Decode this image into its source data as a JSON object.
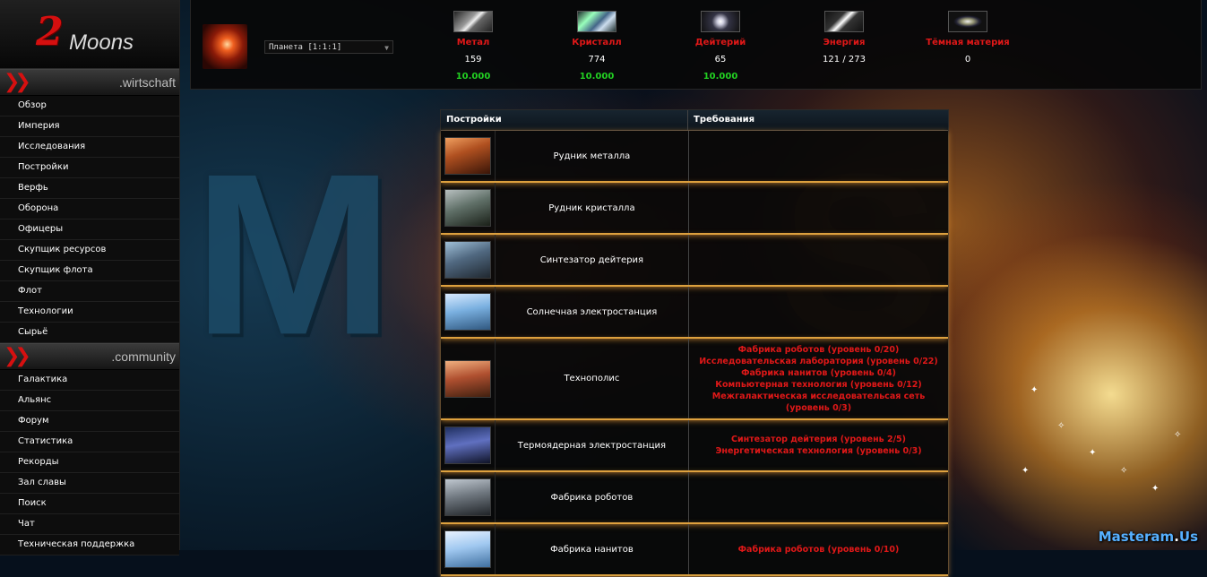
{
  "logo": {
    "number": "2",
    "word": "Moons"
  },
  "menu": {
    "sections": [
      {
        "title": ".wirtschaft",
        "items": [
          "Обзор",
          "Империя",
          "Исследования",
          "Постройки",
          "Верфь",
          "Оборона",
          "Офицеры",
          "Скупщик ресурсов",
          "Скупщик флота",
          "Флот",
          "Технологии",
          "Сырьё"
        ]
      },
      {
        "title": ".community",
        "items": [
          "Галактика",
          "Альянс",
          "Форум",
          "Статистика",
          "Рекорды",
          "Зал славы",
          "Поиск",
          "Чат",
          "Техническая поддержка"
        ]
      }
    ]
  },
  "topbar": {
    "planet_select": "Планета [1:1:1]",
    "resources": [
      {
        "name": "Метал",
        "amount": "159",
        "capacity": "10.000",
        "icon": "metal-icon"
      },
      {
        "name": "Кристалл",
        "amount": "774",
        "capacity": "10.000",
        "icon": "crystal-icon"
      },
      {
        "name": "Дейтерий",
        "amount": "65",
        "capacity": "10.000",
        "icon": "deuterium-icon"
      },
      {
        "name": "Энергия",
        "amount": "121 / 273",
        "capacity": "",
        "icon": "energy-icon"
      },
      {
        "name": "Тёмная материя",
        "amount": "0",
        "capacity": "",
        "icon": "dark-matter-icon"
      }
    ]
  },
  "table": {
    "headers": {
      "buildings": "Постройки",
      "requirements": "Требования"
    },
    "rows": [
      {
        "name": "Рудник металла",
        "requirements": []
      },
      {
        "name": "Рудник кристалла",
        "requirements": []
      },
      {
        "name": "Синтезатор дейтерия",
        "requirements": []
      },
      {
        "name": "Солнечная электростанция",
        "requirements": []
      },
      {
        "name": "Технополис",
        "requirements": [
          "Фабрика роботов (уровень 0/20)",
          "Исследовательская лаборатория (уровень 0/22)",
          "Фабрика нанитов (уровень 0/4)",
          "Компьютерная технология (уровень 0/12)",
          "Межгалактическая исследовательсая сеть (уровень 0/3)"
        ]
      },
      {
        "name": "Термоядерная электростанция",
        "requirements": [
          "Синтезатор дейтерия (уровень 2/5)",
          "Энергетическая технология (уровень 0/3)"
        ]
      },
      {
        "name": "Фабрика роботов",
        "requirements": []
      },
      {
        "name": "Фабрика нанитов",
        "requirements": [
          "Фабрика роботов (уровень 0/10)"
        ]
      }
    ]
  },
  "background": {
    "watermark_left": "Masteram",
    "watermark_right": "Us"
  },
  "colors": {
    "accent_red": "#e01818",
    "capacity_green": "#22d022",
    "row_glow": "#d8a040"
  }
}
